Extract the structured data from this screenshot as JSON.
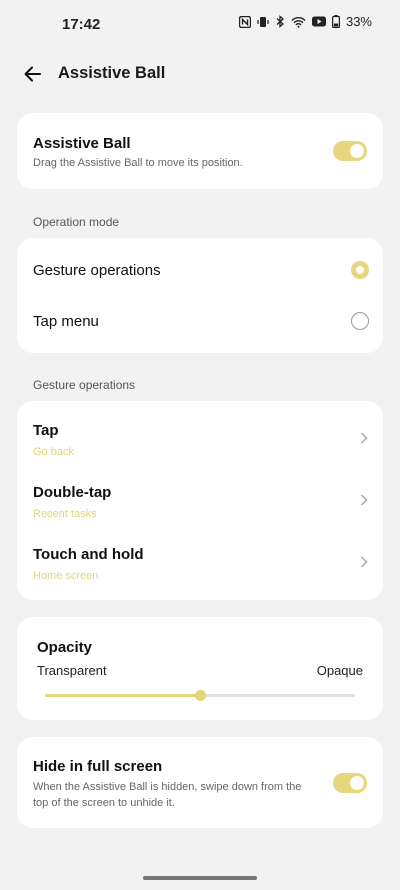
{
  "status_bar": {
    "time": "17:42",
    "icons": [
      "nfc-icon",
      "vibrate-icon",
      "bluetooth-icon",
      "wifi-icon",
      "youtube-icon",
      "battery-icon"
    ],
    "battery": "33%"
  },
  "header": {
    "title": "Assistive Ball",
    "back_icon": "arrow-left-icon"
  },
  "assistive_ball": {
    "title": "Assistive Ball",
    "subtitle": "Drag the Assistive Ball to move its position.",
    "enabled": true
  },
  "operation_mode": {
    "section_label": "Operation mode",
    "options": [
      {
        "label": "Gesture operations",
        "selected": true
      },
      {
        "label": "Tap menu",
        "selected": false
      }
    ]
  },
  "gesture_operations": {
    "section_label": "Gesture operations",
    "items": [
      {
        "title": "Tap",
        "value": "Go back"
      },
      {
        "title": "Double-tap",
        "value": "Recent tasks"
      },
      {
        "title": "Touch and hold",
        "value": "Home screen"
      }
    ]
  },
  "opacity": {
    "title": "Opacity",
    "min_label": "Transparent",
    "max_label": "Opaque",
    "value_fraction": 0.5
  },
  "hide_full_screen": {
    "title": "Hide in full screen",
    "subtitle": "When the Assistive Ball is hidden, swipe down from the top of the screen to unhide it.",
    "enabled": true
  },
  "colors": {
    "accent": "#e8d67c",
    "background": "#f2f2f2",
    "card": "#ffffff"
  }
}
